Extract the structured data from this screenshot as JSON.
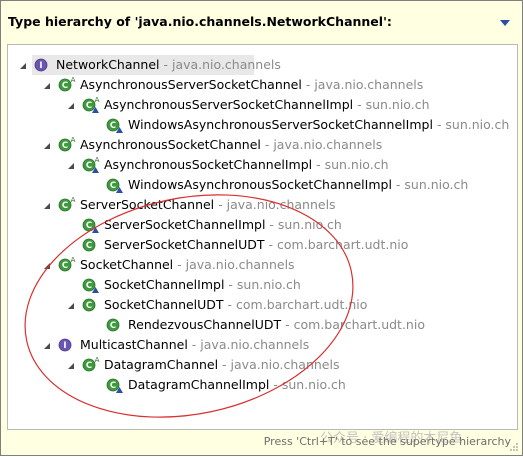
{
  "header": {
    "title": "Type hierarchy of 'java.nio.channels.NetworkChannel':"
  },
  "tree": {
    "root": {
      "name": "NetworkChannel",
      "package": " - java.nio.channels",
      "kind": "interface",
      "expanded": true
    },
    "nodes": [
      {
        "name": "AsynchronousServerSocketChannel",
        "package": " - java.nio.channels",
        "kind": "abstract-class",
        "expanded": true
      },
      {
        "name": "AsynchronousServerSocketChannelImpl",
        "package": " - sun.nio.ch",
        "kind": "abstract-class-restricted",
        "expanded": true
      },
      {
        "name": "WindowsAsynchronousServerSocketChannelImpl",
        "package": " - sun.nio.ch",
        "kind": "class-restricted"
      },
      {
        "name": "AsynchronousSocketChannel",
        "package": " - java.nio.channels",
        "kind": "abstract-class",
        "expanded": true
      },
      {
        "name": "AsynchronousSocketChannelImpl",
        "package": " - sun.nio.ch",
        "kind": "abstract-class-restricted",
        "expanded": true
      },
      {
        "name": "WindowsAsynchronousSocketChannelImpl",
        "package": " - sun.nio.ch",
        "kind": "class-restricted"
      },
      {
        "name": "ServerSocketChannel",
        "package": " - java.nio.channels",
        "kind": "abstract-class",
        "expanded": true
      },
      {
        "name": "ServerSocketChannelImpl",
        "package": " - sun.nio.ch",
        "kind": "class-restricted"
      },
      {
        "name": "ServerSocketChannelUDT",
        "package": " - com.barchart.udt.nio",
        "kind": "class"
      },
      {
        "name": "SocketChannel",
        "package": " - java.nio.channels",
        "kind": "abstract-class",
        "expanded": true
      },
      {
        "name": "SocketChannelImpl",
        "package": " - sun.nio.ch",
        "kind": "class-restricted"
      },
      {
        "name": "SocketChannelUDT",
        "package": " - com.barchart.udt.nio",
        "kind": "class",
        "expanded": true
      },
      {
        "name": "RendezvousChannelUDT",
        "package": " - com.barchart.udt.nio",
        "kind": "class"
      },
      {
        "name": "MulticastChannel",
        "package": " - java.nio.channels",
        "kind": "interface",
        "expanded": true
      },
      {
        "name": "DatagramChannel",
        "package": " - java.nio.channels",
        "kind": "abstract-class",
        "expanded": true
      },
      {
        "name": "DatagramChannelImpl",
        "package": " - sun.nio.ch",
        "kind": "class-restricted"
      }
    ]
  },
  "footer": {
    "status": "Press 'Ctrl+T' to see the supertype hierarchy",
    "watermark": "公众号 · 爱编程的木尼鱼"
  },
  "colors": {
    "class_green": "#3d9b3d",
    "interface_purple": "#6a55b0",
    "package_gray": "#8a8a8a",
    "annotation_red": "#d93030",
    "popup_bg": "#ffffe1"
  }
}
